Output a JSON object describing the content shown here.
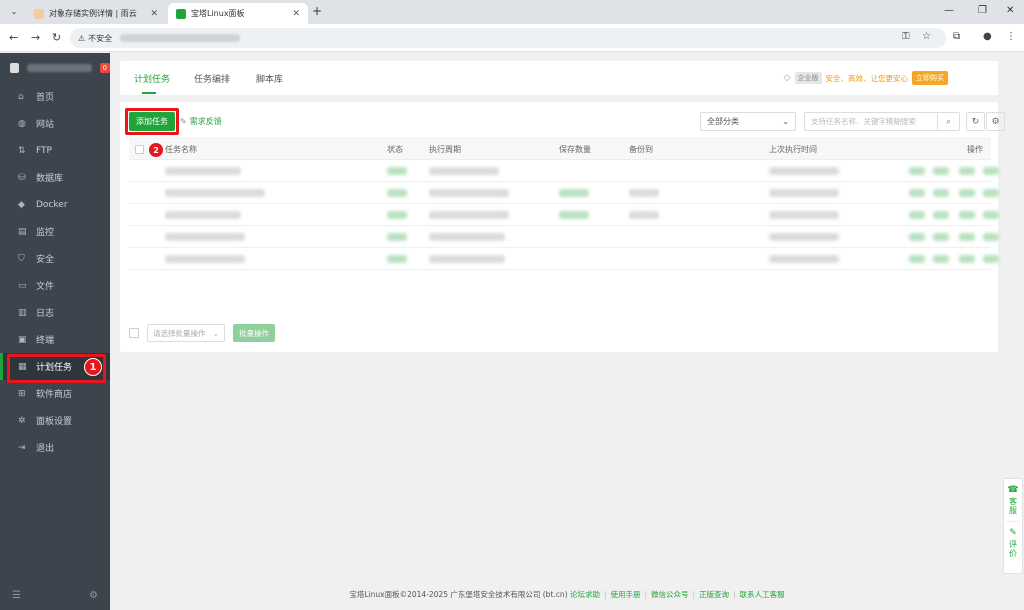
{
  "browser": {
    "tabs": [
      {
        "title": "对象存储实例详情 | 雨云"
      },
      {
        "title": "宝塔Linux面板"
      }
    ],
    "insecure_label": "不安全"
  },
  "sidebar": {
    "badge": "0",
    "items": [
      {
        "label": "首页",
        "icon": "home-icon"
      },
      {
        "label": "网站",
        "icon": "globe-icon"
      },
      {
        "label": "FTP",
        "icon": "ftp-icon"
      },
      {
        "label": "数据库",
        "icon": "database-icon"
      },
      {
        "label": "Docker",
        "icon": "docker-icon"
      },
      {
        "label": "监控",
        "icon": "monitor-icon"
      },
      {
        "label": "安全",
        "icon": "shield-icon"
      },
      {
        "label": "文件",
        "icon": "folder-icon"
      },
      {
        "label": "日志",
        "icon": "log-icon"
      },
      {
        "label": "终端",
        "icon": "terminal-icon"
      },
      {
        "label": "计划任务",
        "icon": "cron-icon"
      },
      {
        "label": "软件商店",
        "icon": "store-icon"
      },
      {
        "label": "面板设置",
        "icon": "settings-icon"
      },
      {
        "label": "退出",
        "icon": "logout-icon"
      }
    ]
  },
  "main": {
    "tabs": [
      {
        "label": "计划任务"
      },
      {
        "label": "任务编排"
      },
      {
        "label": "脚本库"
      }
    ],
    "promo": {
      "tag": "企业版",
      "slogan": "安全、高效、让您更安心",
      "buy": "立即购买"
    },
    "toolbar": {
      "add_label": "添加任务",
      "feedback_label": "需求反馈",
      "category": "全部分类",
      "search_placeholder": "支持任务名称、关键字模糊搜索"
    },
    "table": {
      "headers": [
        "任务名称",
        "状态",
        "执行周期",
        "保存数量",
        "备份到",
        "上次执行时间",
        "操作"
      ]
    },
    "batch": {
      "select_placeholder": "请选择批量操作",
      "button": "批量操作"
    },
    "footer": {
      "copyright": "宝塔Linux面板©2014-2025 广东堡塔安全技术有限公司 (bt.cn)",
      "links": [
        "论坛求助",
        "使用手册",
        "微信公众号",
        "正版查询",
        "联系人工客服"
      ]
    },
    "float": {
      "service": "客服",
      "review": "评价"
    }
  },
  "annotations": {
    "step1": "1",
    "step2": "2"
  },
  "colors": {
    "accent": "#20a53a",
    "sidebar": "#3c444d",
    "highlight": "#e8161b"
  }
}
